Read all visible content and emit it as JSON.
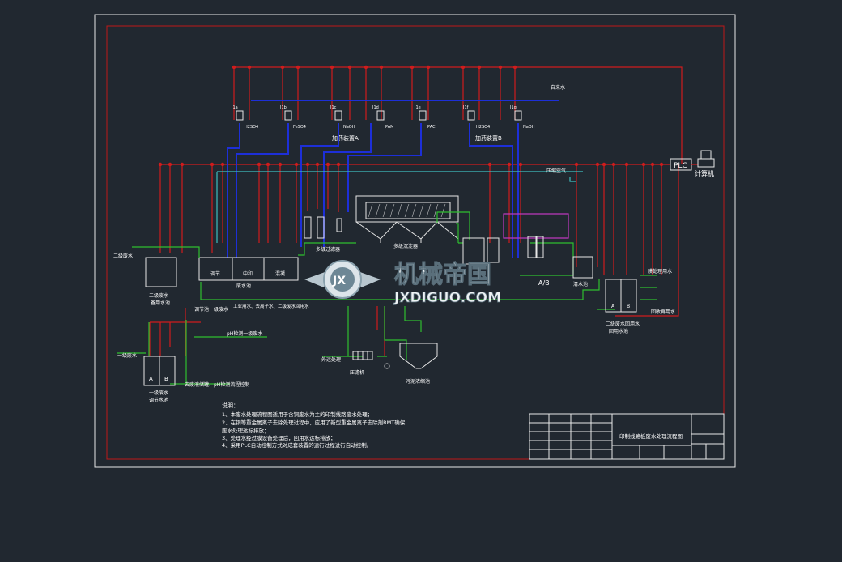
{
  "colors": {
    "background": "#212830",
    "frame": "#e8e8e8",
    "border": "#c01818",
    "signal": "#d01c1c",
    "dosing": "#1d2fd8",
    "water": "#2fbf2f",
    "air": "#3fbfbf",
    "equipment": "#e6e6e6",
    "tank_fill": "#1a1f26",
    "magenta": "#c23ac2"
  },
  "labels": {
    "tap_water": "自来水",
    "compressed_air": "压缩空气",
    "plc": "PLC",
    "computer": "计算机",
    "dosing_a": "加药装置A",
    "dosing_b": "加药装置B",
    "coarse_filter": "多级过滤器",
    "inclined_settler": "多级沉淀器",
    "tank_group_left": "二级废水",
    "reserve_tank_left": "备用水池",
    "reuse_tank": "回用水箱",
    "waste_tank": "废水池",
    "waste_cells": [
      "调节",
      "中和",
      "混凝"
    ],
    "mid_note": "工业用水、去离子水、二级废水回用水",
    "tank_ab": "A/B",
    "clean_tank": "清水池",
    "right_tank": "二级废水回用水",
    "right_tank2": "回用水池",
    "right_in": "膜处理用水",
    "right_out": "回收再用水",
    "left_in": "二级废水",
    "left_in2": "一级废水",
    "ph_line": "pH检测一级废水",
    "neutral_line": "调节池一级废水",
    "bottom_tank": "一级废水",
    "bottom_tank2": "调节水池",
    "bottom_note": "去废液储罐、pH检测流程控制",
    "filter_press": "压滤机",
    "sludge_tank": "污泥浓缩池",
    "sludge_out": "外运处理",
    "sludge_pump": "泥浆泵",
    "cell_a": "A",
    "cell_b": "B"
  },
  "pumps": [
    {
      "tag": "J1a",
      "chem": "H2SO4"
    },
    {
      "tag": "J1b",
      "chem": "FeSO4"
    },
    {
      "tag": "J1c",
      "chem": "NaOH"
    },
    {
      "tag": "J1d",
      "chem": "PAM"
    },
    {
      "tag": "J1e",
      "chem": "PAC"
    },
    {
      "tag": "J1f",
      "chem": "H2SO4"
    },
    {
      "tag": "J1g",
      "chem": "NaOH"
    }
  ],
  "watermark": {
    "cn": "机械帝国",
    "en": "JXDIGUO.COM",
    "emblem": "JX"
  },
  "notes": {
    "title": "说明：",
    "items": [
      "1、本废水处理流程图适用于含铜废水为主的印制线路废水处理；",
      "2、在铜等重金属离子去除处理过程中，应用了新型重金属离子去除剂RMT确保",
      "    废水处理达标排放；",
      "3、处理水经过膜设备处理后，回用水达标排放；",
      "4、采用PLC自动控制方式对成套装置的运行过程进行自动控制。"
    ]
  },
  "title_block": {
    "drawing_title": "印制线路板废水处理流程图"
  }
}
